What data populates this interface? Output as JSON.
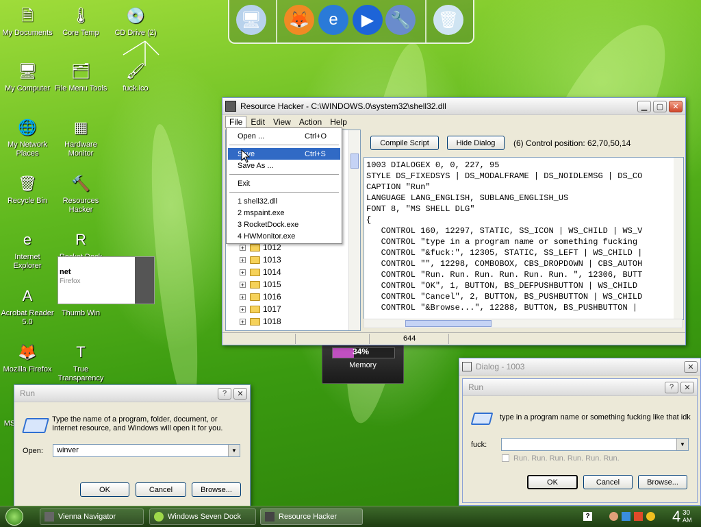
{
  "desktop": {
    "icons": [
      {
        "label": "My Documents",
        "glyph": "🗎",
        "icon": "documents-icon"
      },
      {
        "label": "Core Temp",
        "glyph": "🌡",
        "icon": "thermometer-icon"
      },
      {
        "label": "CD Drive (2)",
        "glyph": "💿",
        "icon": "cd-drive-icon"
      },
      {
        "label": "My Computer",
        "glyph": "🖥",
        "icon": "computer-icon"
      },
      {
        "label": "File Menu Tools",
        "glyph": "🗂",
        "icon": "file-menu-tools-icon"
      },
      {
        "label": "fuck.ico",
        "glyph": "🖌",
        "icon": "ico-file-icon"
      },
      {
        "label": "My Network Places",
        "glyph": "🌐",
        "icon": "network-icon"
      },
      {
        "label": "Hardware Monitor",
        "glyph": "▦",
        "icon": "hardware-monitor-icon"
      },
      {
        "label": "Recycle Bin",
        "glyph": "🗑",
        "icon": "recycle-bin-icon"
      },
      {
        "label": "Resources Hacker",
        "glyph": "🔨",
        "icon": "resource-hacker-icon"
      },
      {
        "label": "Internet Explorer",
        "glyph": "e",
        "icon": "internet-explorer-icon"
      },
      {
        "label": "Rocket Dock",
        "glyph": "R",
        "icon": "rocketdock-icon"
      },
      {
        "label": "Acrobat Reader 5.0",
        "glyph": "A",
        "icon": "acrobat-icon"
      },
      {
        "label": "Thumb Win",
        "glyph": "▤",
        "icon": "thumb-win-icon"
      },
      {
        "label": "Mozilla Firefox",
        "glyph": "🦊",
        "icon": "firefox-icon"
      },
      {
        "label": "True Transparency",
        "glyph": "T",
        "icon": "true-transparency-icon"
      }
    ],
    "partial_label": "MS",
    "thumb_popup": {
      "line1": "net",
      "line2": "Firefox"
    }
  },
  "dock": {
    "items": [
      {
        "name": "dock-computer-icon",
        "glyph": "🖥"
      },
      {
        "name": "dock-firefox-icon",
        "glyph": "🦊"
      },
      {
        "name": "dock-ie-icon",
        "glyph": "e"
      },
      {
        "name": "dock-media-player-icon",
        "glyph": "▶"
      },
      {
        "name": "dock-tool-icon",
        "glyph": "🔧"
      },
      {
        "name": "dock-recycle-bin-icon",
        "glyph": "🗑"
      }
    ]
  },
  "memory_gadget": {
    "percent": "34%",
    "label": "Memory",
    "fill": 0.34
  },
  "reshacker": {
    "title": "Resource Hacker   -  C:\\WINDOWS.0\\system32\\shell32.dll",
    "menu": [
      "File",
      "Edit",
      "View",
      "Action",
      "Help"
    ],
    "file_menu": {
      "items": [
        {
          "label": "Open ...",
          "shortcut": "Ctrl+O"
        },
        {
          "label": "Save",
          "shortcut": "Ctrl+S"
        },
        {
          "label": "Save As ...",
          "shortcut": ""
        },
        {
          "label": "Exit",
          "shortcut": ""
        },
        {
          "label": "1 shell32.dll",
          "shortcut": ""
        },
        {
          "label": "2 mspaint.exe",
          "shortcut": ""
        },
        {
          "label": "3 RocketDock.exe",
          "shortcut": ""
        },
        {
          "label": "4 HWMonitor.exe",
          "shortcut": ""
        }
      ]
    },
    "compile_label": "Compile Script",
    "hide_label": "Hide Dialog",
    "control_pos": "(6)  Control position: 62,70,50,14",
    "tree": [
      "1012",
      "1013",
      "1014",
      "1015",
      "1016",
      "1017",
      "1018"
    ],
    "code": [
      "1003 DIALOGEX 0, 0, 227, 95",
      "STYLE DS_FIXEDSYS | DS_MODALFRAME | DS_NOIDLEMSG | DS_CO",
      "CAPTION \"Run\"",
      "LANGUAGE LANG_ENGLISH, SUBLANG_ENGLISH_US",
      "FONT 8, \"MS SHELL DLG\"",
      "{",
      "   CONTROL 160, 12297, STATIC, SS_ICON | WS_CHILD | WS_V",
      "   CONTROL \"type in a program name or something fucking",
      "   CONTROL \"&fuck:\", 12305, STATIC, SS_LEFT | WS_CHILD |",
      "   CONTROL \"\", 12298, COMBOBOX, CBS_DROPDOWN | CBS_AUTOH",
      "   CONTROL \"Run. Run. Run. Run. Run. Run. \", 12306, BUTT",
      "   CONTROL \"OK\", 1, BUTTON, BS_DEFPUSHBUTTON | WS_CHILD",
      "   CONTROL \"Cancel\", 2, BUTTON, BS_PUSHBUTTON | WS_CHILD",
      "   CONTROL \"&Browse...\", 12288, BUTTON, BS_PUSHBUTTON |"
    ],
    "status_value": "644"
  },
  "run_dialog": {
    "title": "Run",
    "description": "Type the name of a program, folder, document, or Internet resource, and Windows will open it for you.",
    "open_label": "Open:",
    "open_value": "winver",
    "ok": "OK",
    "cancel": "Cancel",
    "browse": "Browse..."
  },
  "preview_dialog": {
    "outer_title": "Dialog - 1003",
    "inner_title": "Run",
    "description": "type in a program name or something fucking like that idk",
    "field_label": "fuck:",
    "checkbox_label": "Run. Run. Run. Run. Run. Run.",
    "ok": "OK",
    "cancel": "Cancel",
    "browse": "Browse..."
  },
  "taskbar": {
    "tasks": [
      {
        "label": "Vienna Navigator"
      },
      {
        "label": "Windows Seven Dock"
      },
      {
        "label": "Resource Hacker"
      }
    ],
    "clock_hour": "4",
    "clock_min": "30",
    "clock_ampm": "AM"
  }
}
